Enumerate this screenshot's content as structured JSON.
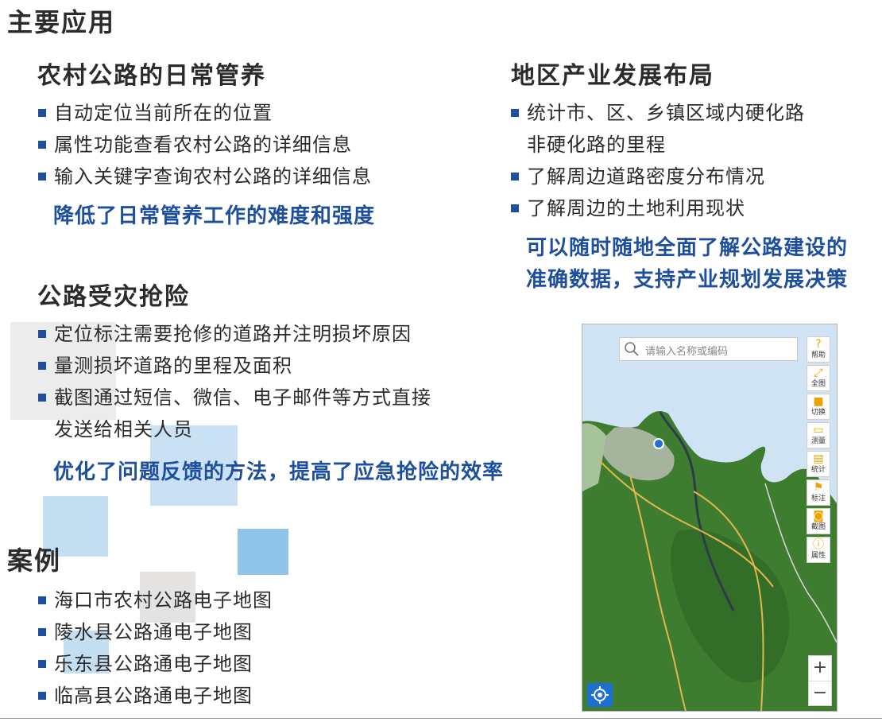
{
  "title": "主要应用",
  "left": {
    "sec1": {
      "title": "农村公路的日常管养",
      "items": [
        "自动定位当前所在的位置",
        "属性功能查看农村公路的详细信息",
        "输入关键字查询农村公路的详细信息"
      ],
      "highlight": "降低了日常管养工作的难度和强度"
    },
    "sec2": {
      "title": "公路受灾抢险",
      "items": [
        "定位标注需要抢修的道路并注明损坏原因",
        "量测损坏道路的里程及面积"
      ],
      "item3_line1": "截图通过短信、微信、电子邮件等方式直接",
      "item3_line2": "发送给相关人员",
      "highlight": "优化了问题反馈的方法，提高了应急抢险的效率"
    },
    "cases": {
      "title": "案例",
      "items": [
        "海口市农村公路电子地图",
        "陵水县公路通电子地图",
        "乐东县公路通电子地图",
        "临高县公路通电子地图"
      ]
    }
  },
  "right": {
    "sec": {
      "title": "地区产业发展布局",
      "item1_line1": "统计市、区、乡镇区域内硬化路",
      "item1_line2": "非硬化路的里程",
      "items": [
        "了解周边道路密度分布情况",
        "了解周边的土地利用现状"
      ],
      "highlight_line1": "可以随时随地全面了解公路建设的",
      "highlight_line2": "准确数据，支持产业规划发展决策"
    }
  },
  "map": {
    "search_placeholder": "请输入名称或编码",
    "tools": [
      {
        "label": "帮助",
        "icon": "help-icon"
      },
      {
        "label": "全图",
        "icon": "full-extent-icon"
      },
      {
        "label": "切换",
        "icon": "switch-layer-icon"
      },
      {
        "label": "测量",
        "icon": "ruler-icon"
      },
      {
        "label": "统计",
        "icon": "statistics-icon"
      },
      {
        "label": "标注",
        "icon": "flag-icon"
      },
      {
        "label": "截图",
        "icon": "camera-icon"
      },
      {
        "label": "属性",
        "icon": "info-icon"
      }
    ],
    "zoom_in": "+",
    "zoom_out": "−"
  },
  "colors": {
    "accent": "#1d4f9e",
    "heading": "#2b2b2b",
    "deco_light_blue": "#c5dff2",
    "deco_blue": "#8ec5e8",
    "deco_gray": "#ededed",
    "map_land": "#3a7a2c"
  }
}
